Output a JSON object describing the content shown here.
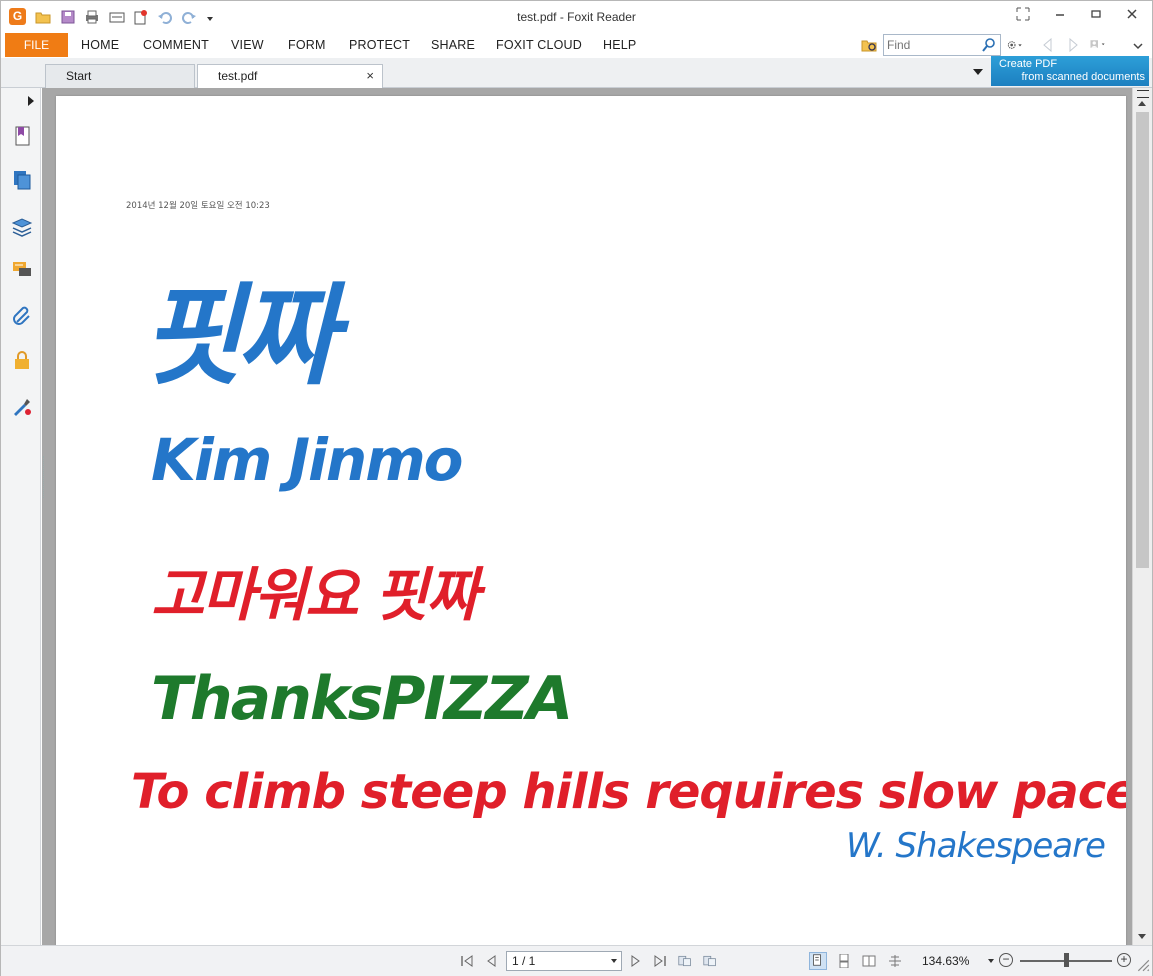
{
  "window": {
    "title": "test.pdf - Foxit Reader",
    "app_logo_letter": "G"
  },
  "quick_access": [
    "open-folder-icon",
    "save-icon",
    "print-icon",
    "scan-icon",
    "new-pdf-icon",
    "undo-icon",
    "redo-icon",
    "customize-dropdown-icon"
  ],
  "window_controls": [
    "fullscreen-icon",
    "minimize-icon",
    "restore-icon",
    "close-icon"
  ],
  "menu": {
    "file": "FILE",
    "items": [
      "HOME",
      "COMMENT",
      "VIEW",
      "FORM",
      "PROTECT",
      "SHARE",
      "FOXIT CLOUD",
      "HELP"
    ]
  },
  "search": {
    "placeholder": "Find",
    "value": ""
  },
  "tabs": [
    {
      "label": "Start",
      "active": false
    },
    {
      "label": "test.pdf",
      "active": true,
      "close": "×"
    }
  ],
  "ad_banner": {
    "line1": "Create PDF",
    "line2": "from scanned documents"
  },
  "left_nav": [
    "bookmarks-icon",
    "pages-icon",
    "layers-icon",
    "comments-icon",
    "attachments-icon",
    "security-icon",
    "signature-icon"
  ],
  "document": {
    "date_line": "2014년 12월 20일 토요일      오전 10:23",
    "ink_lines": [
      {
        "text": "핏짜",
        "color": "#2476c9"
      },
      {
        "text": "Kim Jinmo",
        "color": "#2476c9"
      },
      {
        "text": "고마워요 핏짜",
        "color": "#e01f2a"
      },
      {
        "text": "ThanksPIZZA",
        "color": "#1e7a2c"
      },
      {
        "text": "To climb steep hills requires slow pace at first.",
        "color": "#e01f2a"
      },
      {
        "text": "W. Shakespeare",
        "color": "#2476c9"
      }
    ]
  },
  "status": {
    "page_indicator": "1 / 1",
    "zoom": "134.63%"
  },
  "colors": {
    "accent": "#f07c14",
    "banner": "#1c7fc0",
    "viewport_bg": "#a7a7a7"
  }
}
